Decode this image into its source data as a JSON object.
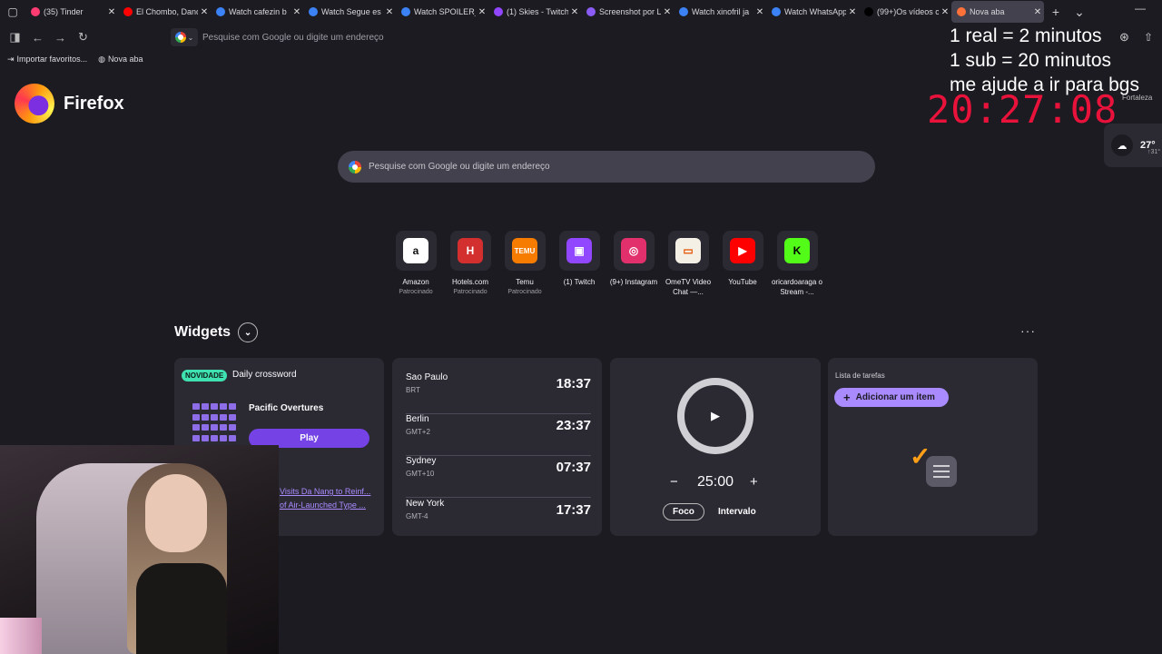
{
  "tabs": [
    {
      "title": "(35) Tinder",
      "color": "#fe3c72"
    },
    {
      "title": "El Chombo, Dancing",
      "color": "#ff0000"
    },
    {
      "title": "Watch cafezin b",
      "color": "#3b82f6"
    },
    {
      "title": "Watch Segue es",
      "color": "#3b82f6"
    },
    {
      "title": "Watch SPOILER_",
      "color": "#3b82f6"
    },
    {
      "title": "(1) Skies - Twitch",
      "color": "#9146ff"
    },
    {
      "title": "Screenshot por L",
      "color": "#8a5cf5"
    },
    {
      "title": "Watch xinofril ja",
      "color": "#3b82f6"
    },
    {
      "title": "Watch WhatsApp",
      "color": "#3b82f6"
    },
    {
      "title": "(99+)Os vídeos c",
      "color": "#000000"
    },
    {
      "title": "Nova aba",
      "color": "#ff7139",
      "active": true
    }
  ],
  "urlbar": {
    "placeholder": "Pesquise com Google ou digite um endereço"
  },
  "bookmarks": [
    {
      "label": "Importar favoritos...",
      "icon": "import-icon"
    },
    {
      "label": "Nova aba",
      "icon": "globe-icon"
    }
  ],
  "brand": {
    "name": "Firefox"
  },
  "overlay": {
    "line1": "1 real = 2 minutos",
    "line2": "1 sub = 20 minutos",
    "line3": "me ajude a ir para bgs",
    "clock": "20:27:08"
  },
  "weather": {
    "temp": "27°",
    "sub": "↑31°",
    "label": "Fortaleza"
  },
  "search": {
    "placeholder": "Pesquise com Google ou digite um endereço"
  },
  "shortcuts": [
    {
      "label": "Amazon",
      "sponsored": "Patrocinado",
      "glyph": "a",
      "bg": "#ffffff",
      "fg": "#111111"
    },
    {
      "label": "Hotels.com",
      "sponsored": "Patrocinado",
      "glyph": "H",
      "bg": "#d32f2f",
      "fg": "#ffffff"
    },
    {
      "label": "Temu",
      "sponsored": "Patrocinado",
      "glyph": "TEMU",
      "bg": "#f57c00",
      "fg": "#ffffff"
    },
    {
      "label": "(1) Twitch",
      "sponsored": "",
      "glyph": "▣",
      "bg": "#9146ff",
      "fg": "#ffffff"
    },
    {
      "label": "(9+) Instagram",
      "sponsored": "",
      "glyph": "◎",
      "bg": "#e1306c",
      "fg": "#ffffff"
    },
    {
      "label": "OmeTV Video Chat —...",
      "sponsored": "",
      "glyph": "▭",
      "bg": "#f5f0e6",
      "fg": "#e65100"
    },
    {
      "label": "YouTube",
      "sponsored": "",
      "glyph": "▶",
      "bg": "#ff0000",
      "fg": "#ffffff"
    },
    {
      "label": "oricardoaraga o Stream -...",
      "sponsored": "",
      "glyph": "K",
      "bg": "#53fc18",
      "fg": "#000000"
    }
  ],
  "widgets": {
    "title": "Widgets",
    "crossword": {
      "badge": "NOVIDADE",
      "title": "Daily crossword",
      "puzzle": "Pacific Overtures",
      "play": "Play",
      "news1": "Visits Da Nang to Reinf...",
      "news2": "of Air-Launched Type ..."
    },
    "clocks": [
      {
        "city": "Sao Paulo",
        "tz": "BRT",
        "time": "18:37"
      },
      {
        "city": "Berlin",
        "tz": "GMT+2",
        "time": "23:37"
      },
      {
        "city": "Sydney",
        "tz": "GMT+10",
        "time": "07:37"
      },
      {
        "city": "New York",
        "tz": "GMT-4",
        "time": "17:37"
      }
    ],
    "timer": {
      "value": "25:00",
      "minus": "−",
      "plus": "+",
      "mode1": "Foco",
      "mode2": "Intervalo"
    },
    "tasks": {
      "label": "Lista de tarefas",
      "add": "Adicionar um item"
    }
  }
}
